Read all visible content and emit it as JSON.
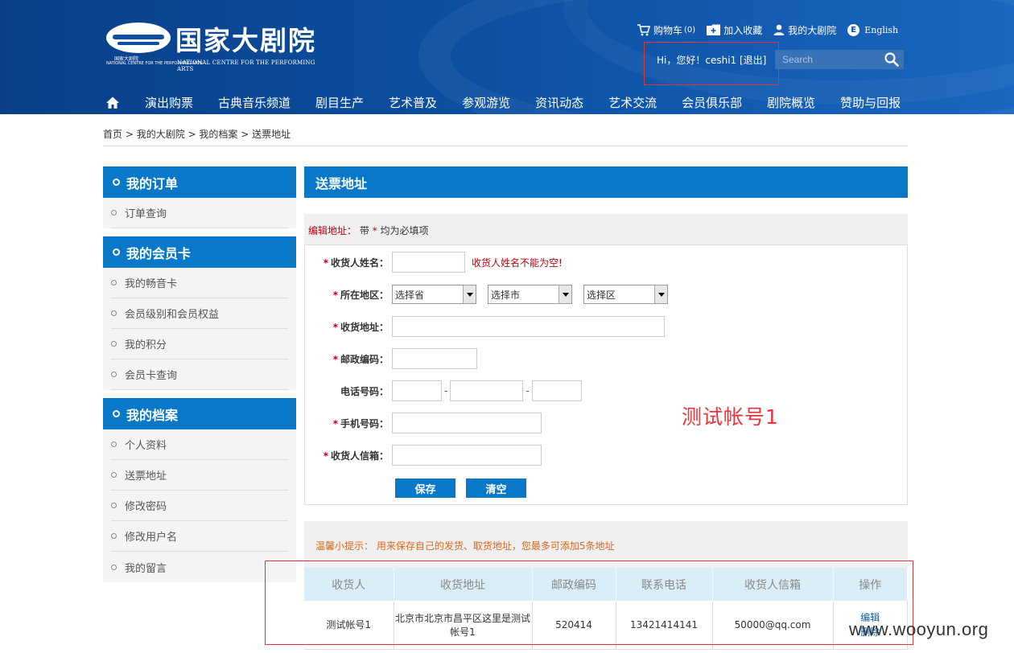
{
  "header": {
    "logo_cn": "国家大剧院",
    "logo_small_cn": "国家大剧院",
    "logo_small_en": "NATIONAL CENTRE FOR THE PERFORMING ARTS",
    "logo_en": "NATIONAL CENTRE FOR THE PERFORMING ARTS",
    "cart_label": "购物车",
    "cart_count": "(0)",
    "favorite_label": "加入收藏",
    "my_theatre_label": "我的大剧院",
    "english_badge": "E",
    "english_label": "English",
    "greeting": "Hi，您好！ceshi1 ",
    "logout_label": "[退出]",
    "search_placeholder": "Search"
  },
  "nav": {
    "items": [
      "演出购票",
      "古典音乐频道",
      "剧目生产",
      "艺术普及",
      "参观游览",
      "资讯动态",
      "艺术交流",
      "会员俱乐部",
      "剧院概览",
      "赞助与回报"
    ]
  },
  "breadcrumb": {
    "items": [
      "首页",
      "我的大剧院",
      "我的档案",
      "送票地址"
    ],
    "separator": " > "
  },
  "sidebar": {
    "groups": [
      {
        "title": "我的订单",
        "items": [
          "订单查询"
        ]
      },
      {
        "title": "我的会员卡",
        "items": [
          "我的畅音卡",
          "会员级别和会员权益",
          "我的积分",
          "会员卡查询"
        ]
      },
      {
        "title": "我的档案",
        "items": [
          "个人资料",
          "送票地址",
          "修改密码",
          "修改用户名",
          "我的留言"
        ]
      }
    ]
  },
  "main": {
    "title": "送票地址",
    "form_note_label": "编辑地址：",
    "form_note_pre": "带",
    "form_note_star": "*",
    "form_note_post": "均为必填项",
    "fields": {
      "name": "收货人姓名：",
      "name_error": "收货人姓名不能为空!",
      "region": "所在地区：",
      "province": "选择省",
      "city": "选择市",
      "district": "选择区",
      "address": "收货地址：",
      "postcode": "邮政编码：",
      "phone": "电话号码：",
      "phone_sep": "-",
      "mobile": "手机号码：",
      "email": "收货人信箱："
    },
    "required_star": "*",
    "save_label": "保存",
    "clear_label": "清空",
    "annotation": "测试帐号1",
    "tip": "温馨小提示：  用来保存自己的发货、取货地址，您最多可添加5条地址"
  },
  "table": {
    "headers": [
      "收货人",
      "收货地址",
      "邮政编码",
      "联系电话",
      "收货人信箱",
      "操作"
    ],
    "rows": [
      {
        "name": "测试帐号1",
        "address": "北京市北京市昌平区这里是测试帐号1",
        "postcode": "520414",
        "phone": "13421414141",
        "email": "50000@qq.com",
        "edit": "编辑",
        "delete": "删除"
      }
    ]
  },
  "watermark": "www.wooyun.org",
  "colors": {
    "header_blue": "#0b4fa0",
    "panel_blue": "#0a78c9",
    "required_red": "#c0000f",
    "tip_orange": "#e0671a",
    "highlight_red": "#d63a3a"
  }
}
